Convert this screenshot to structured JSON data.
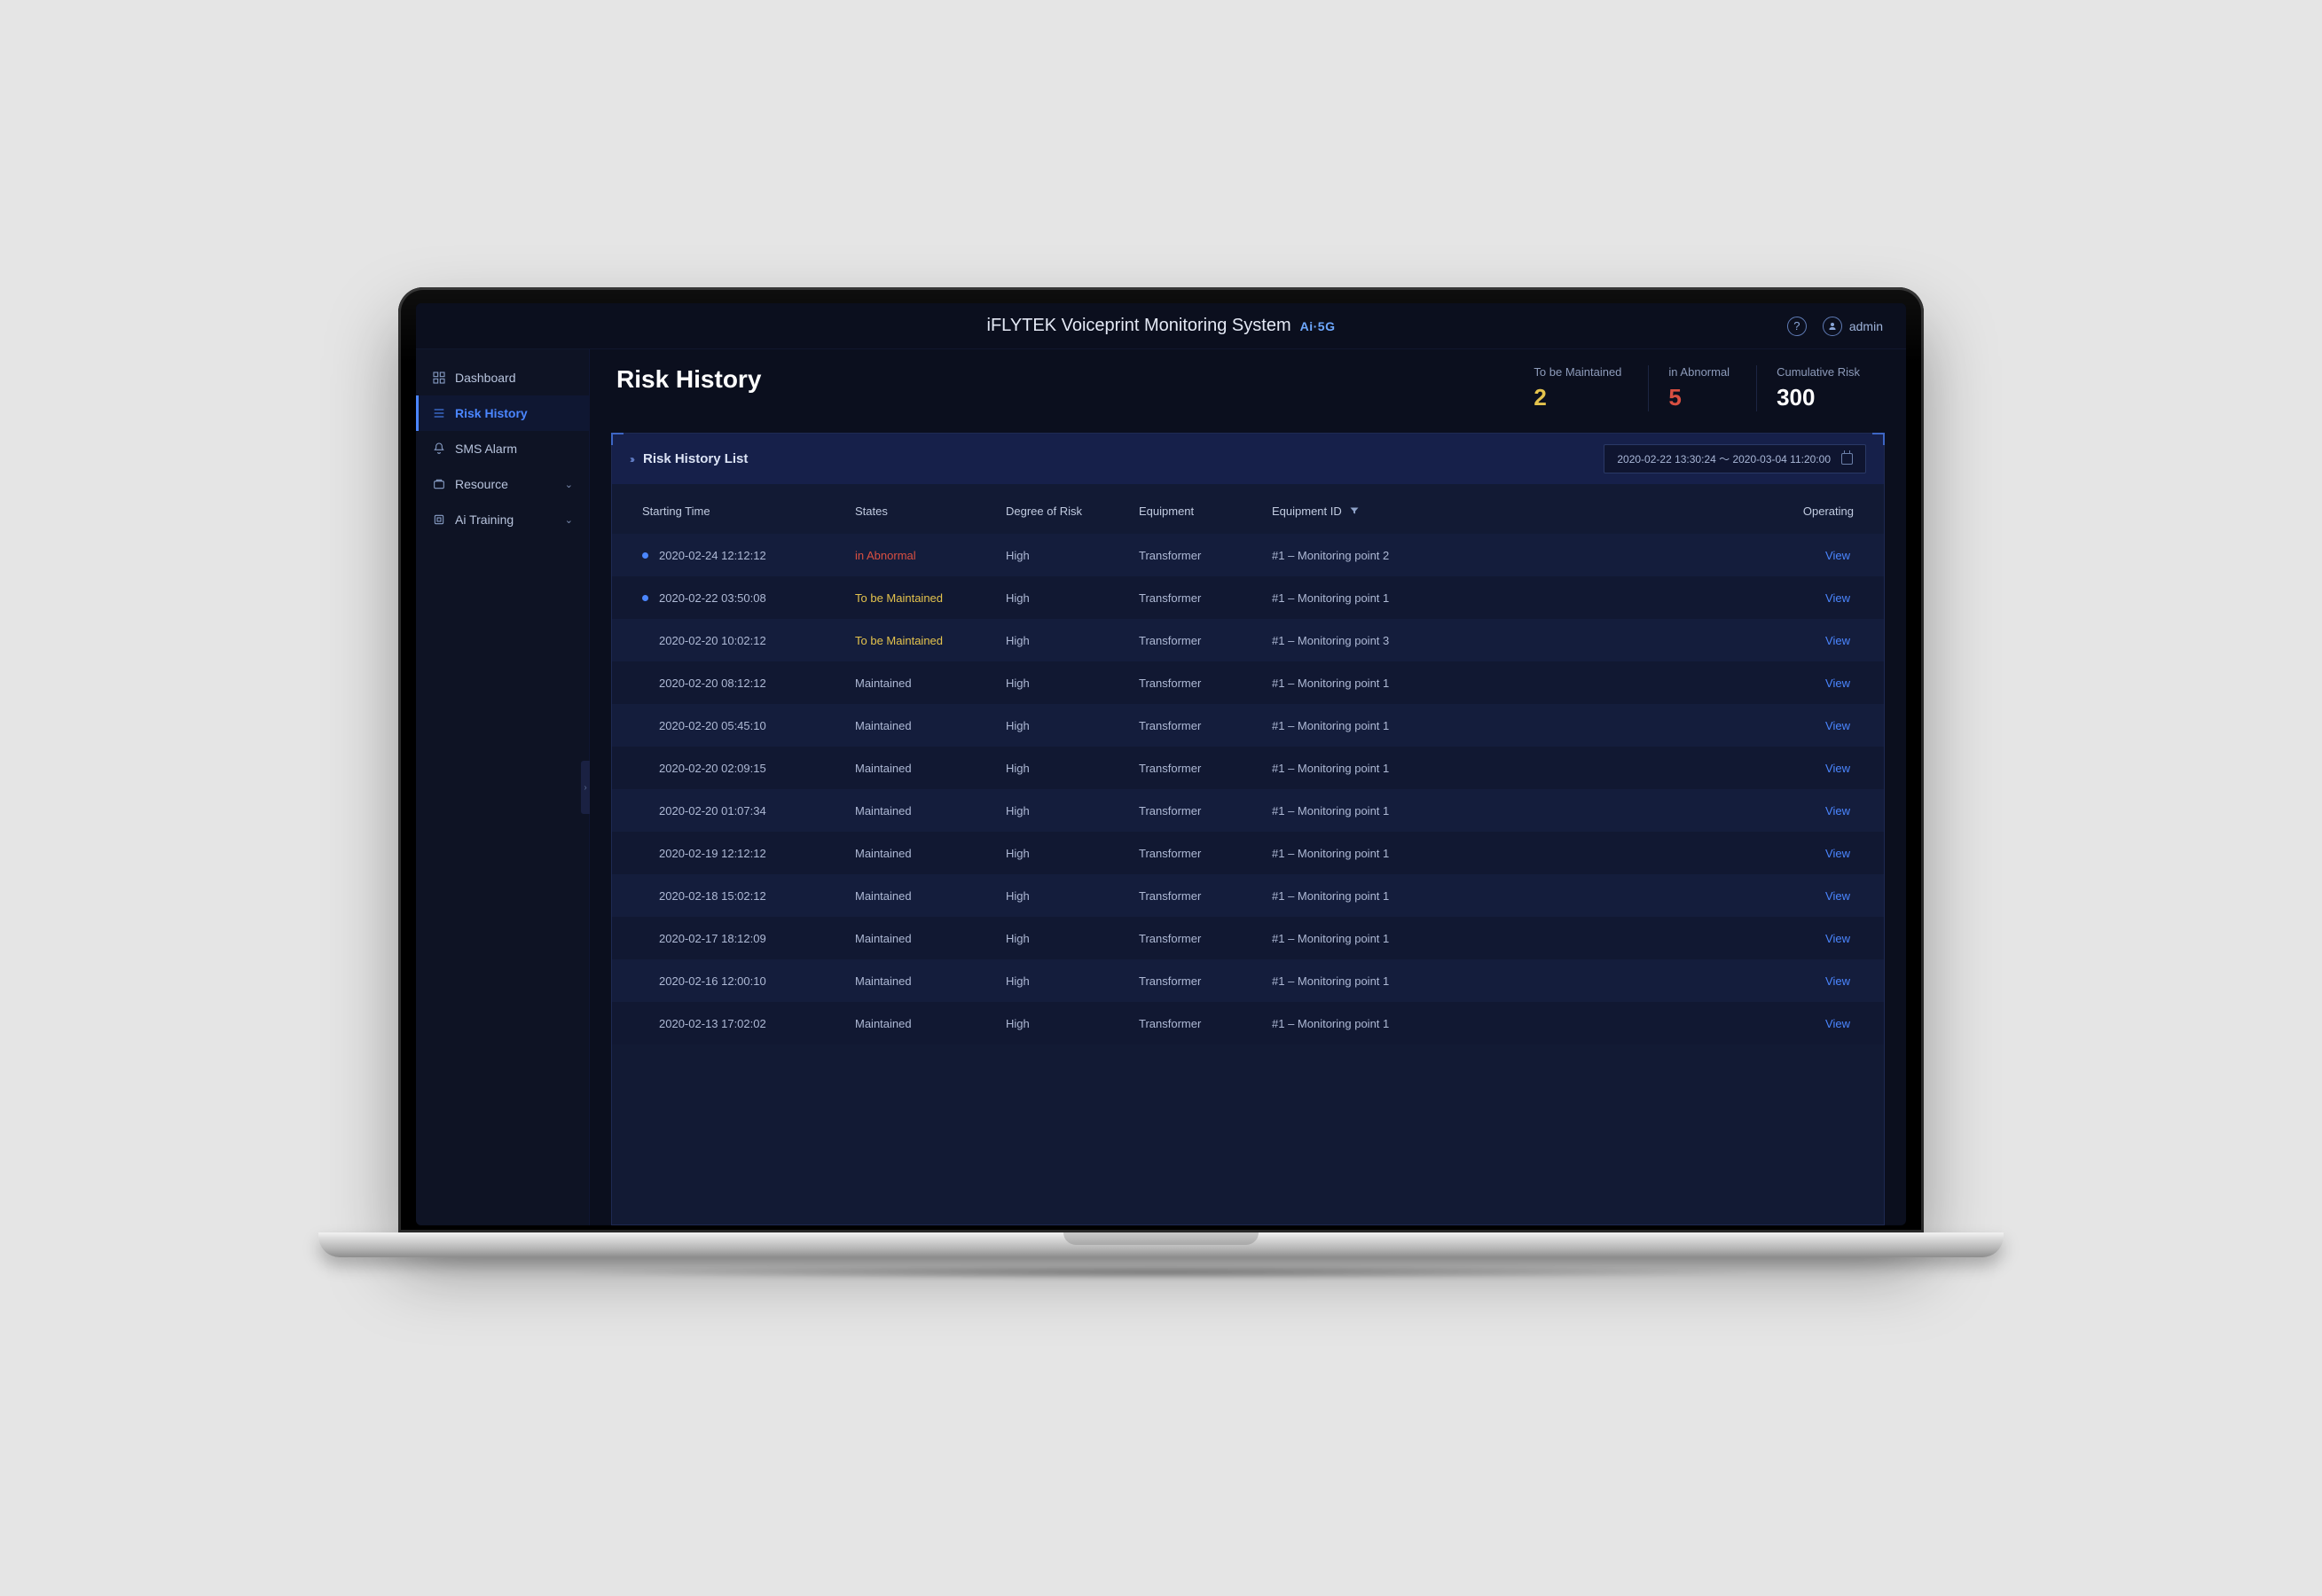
{
  "app_title": "iFLYTEK Voiceprint Monitoring System",
  "brand_badge": "Ai·5G",
  "user_name": "admin",
  "sidebar": {
    "items": [
      {
        "label": "Dashboard",
        "icon": "grid",
        "active": false,
        "expandable": false
      },
      {
        "label": "Risk History",
        "icon": "list",
        "active": true,
        "expandable": false
      },
      {
        "label": "SMS Alarm",
        "icon": "bell",
        "active": false,
        "expandable": false
      },
      {
        "label": "Resource",
        "icon": "cube",
        "active": false,
        "expandable": true
      },
      {
        "label": "Ai Training",
        "icon": "chip",
        "active": false,
        "expandable": true
      }
    ]
  },
  "page": {
    "title": "Risk History",
    "stats": [
      {
        "label": "To be Maintained",
        "value": "2",
        "color": "c-yellow"
      },
      {
        "label": "in Abnormal",
        "value": "5",
        "color": "c-red"
      },
      {
        "label": "Cumulative Risk",
        "value": "300",
        "color": "c-white"
      }
    ]
  },
  "panel": {
    "title": "Risk History List",
    "date_range": "2020-02-22  13:30:24 ～ 2020-03-04 11:20:00"
  },
  "columns": {
    "starting_time": "Starting Time",
    "states": "States",
    "degree": "Degree of Risk",
    "equipment": "Equipment",
    "equipment_id": "Equipment  ID",
    "operating": "Operating"
  },
  "operating_label": "View",
  "rows": [
    {
      "marked": true,
      "time": "2020-02-24 12:12:12",
      "state": "in Abnormal",
      "state_class": "state-abnormal",
      "degree": "High",
      "equipment": "Transformer",
      "eid": "#1 – Monitoring point 2"
    },
    {
      "marked": true,
      "time": "2020-02-22 03:50:08",
      "state": "To be Maintained",
      "state_class": "state-maintain",
      "degree": "High",
      "equipment": "Transformer",
      "eid": "#1 – Monitoring point 1"
    },
    {
      "marked": false,
      "time": "2020-02-20 10:02:12",
      "state": "To be Maintained",
      "state_class": "state-maintain",
      "degree": "High",
      "equipment": "Transformer",
      "eid": "#1 – Monitoring point 3"
    },
    {
      "marked": false,
      "time": "2020-02-20 08:12:12",
      "state": "Maintained",
      "state_class": "state-done",
      "degree": "High",
      "equipment": "Transformer",
      "eid": "#1 – Monitoring point 1"
    },
    {
      "marked": false,
      "time": "2020-02-20 05:45:10",
      "state": "Maintained",
      "state_class": "state-done",
      "degree": "High",
      "equipment": "Transformer",
      "eid": "#1 – Monitoring point 1"
    },
    {
      "marked": false,
      "time": "2020-02-20 02:09:15",
      "state": "Maintained",
      "state_class": "state-done",
      "degree": "High",
      "equipment": "Transformer",
      "eid": "#1 – Monitoring point 1"
    },
    {
      "marked": false,
      "time": "2020-02-20 01:07:34",
      "state": "Maintained",
      "state_class": "state-done",
      "degree": "High",
      "equipment": "Transformer",
      "eid": "#1 – Monitoring point 1"
    },
    {
      "marked": false,
      "time": "2020-02-19 12:12:12",
      "state": "Maintained",
      "state_class": "state-done",
      "degree": "High",
      "equipment": "Transformer",
      "eid": "#1 – Monitoring point 1"
    },
    {
      "marked": false,
      "time": "2020-02-18 15:02:12",
      "state": "Maintained",
      "state_class": "state-done",
      "degree": "High",
      "equipment": "Transformer",
      "eid": "#1 – Monitoring point 1"
    },
    {
      "marked": false,
      "time": "2020-02-17 18:12:09",
      "state": "Maintained",
      "state_class": "state-done",
      "degree": "High",
      "equipment": "Transformer",
      "eid": "#1 – Monitoring point 1"
    },
    {
      "marked": false,
      "time": "2020-02-16 12:00:10",
      "state": "Maintained",
      "state_class": "state-done",
      "degree": "High",
      "equipment": "Transformer",
      "eid": "#1 – Monitoring point 1"
    },
    {
      "marked": false,
      "time": "2020-02-13 17:02:02",
      "state": "Maintained",
      "state_class": "state-done",
      "degree": "High",
      "equipment": "Transformer",
      "eid": "#1 – Monitoring point 1"
    }
  ]
}
